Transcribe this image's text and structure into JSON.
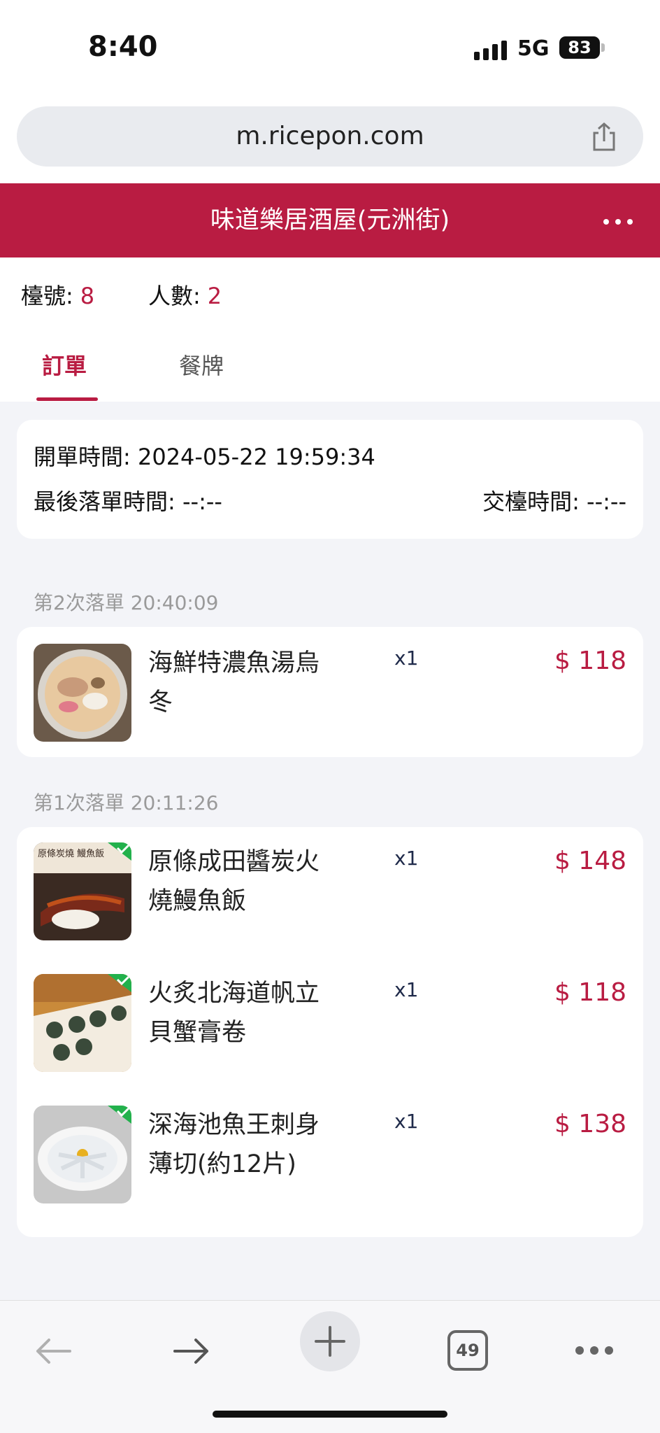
{
  "status_bar": {
    "time": "8:40",
    "network": "5G",
    "battery": "83"
  },
  "browser": {
    "url": "m.ricepon.com",
    "tab_count": "49"
  },
  "header": {
    "title": "味道樂居酒屋(元洲街)"
  },
  "table_info": {
    "table_label": "檯號:",
    "table_value": "8",
    "people_label": "人數:",
    "people_value": "2"
  },
  "tabs": [
    {
      "label": "訂單",
      "active": true
    },
    {
      "label": "餐牌",
      "active": false
    }
  ],
  "order_times": {
    "open_label": "開單時間:",
    "open_value": "2024-05-22 19:59:34",
    "last_order_label": "最後落單時間:",
    "last_order_value": "--:--",
    "checkout_label": "交檯時間:",
    "checkout_value": "--:--"
  },
  "order_batches": [
    {
      "label": "第2次落單",
      "time": "20:40:09",
      "items": [
        {
          "name": "海鮮特濃魚湯烏冬",
          "qty": "x1",
          "price": "$ 118",
          "confirmed": false,
          "image": "udon-soup"
        }
      ]
    },
    {
      "label": "第1次落單",
      "time": "20:11:26",
      "items": [
        {
          "name": "原條成田醬炭火燒鰻魚飯",
          "qty": "x1",
          "price": "$ 148",
          "confirmed": true,
          "image": "eel-rice",
          "image_text": "原條炭燒 鰻魚飯"
        },
        {
          "name": "火炙北海道帆立貝蟹膏卷",
          "qty": "x1",
          "price": "$ 118",
          "confirmed": true,
          "image": "scallop-roll"
        },
        {
          "name": "深海池魚王刺身薄切(約12片)",
          "qty": "x1",
          "price": "$ 138",
          "confirmed": true,
          "image": "sashimi-plate"
        }
      ]
    }
  ],
  "colors": {
    "accent": "#b91c42",
    "confirmed": "#22b14c"
  },
  "icons": {
    "share": "share-icon",
    "more": "more-icon",
    "back": "back-arrow-icon",
    "forward": "forward-arrow-icon",
    "new_tab": "plus-icon",
    "tabs": "tabs-icon"
  }
}
